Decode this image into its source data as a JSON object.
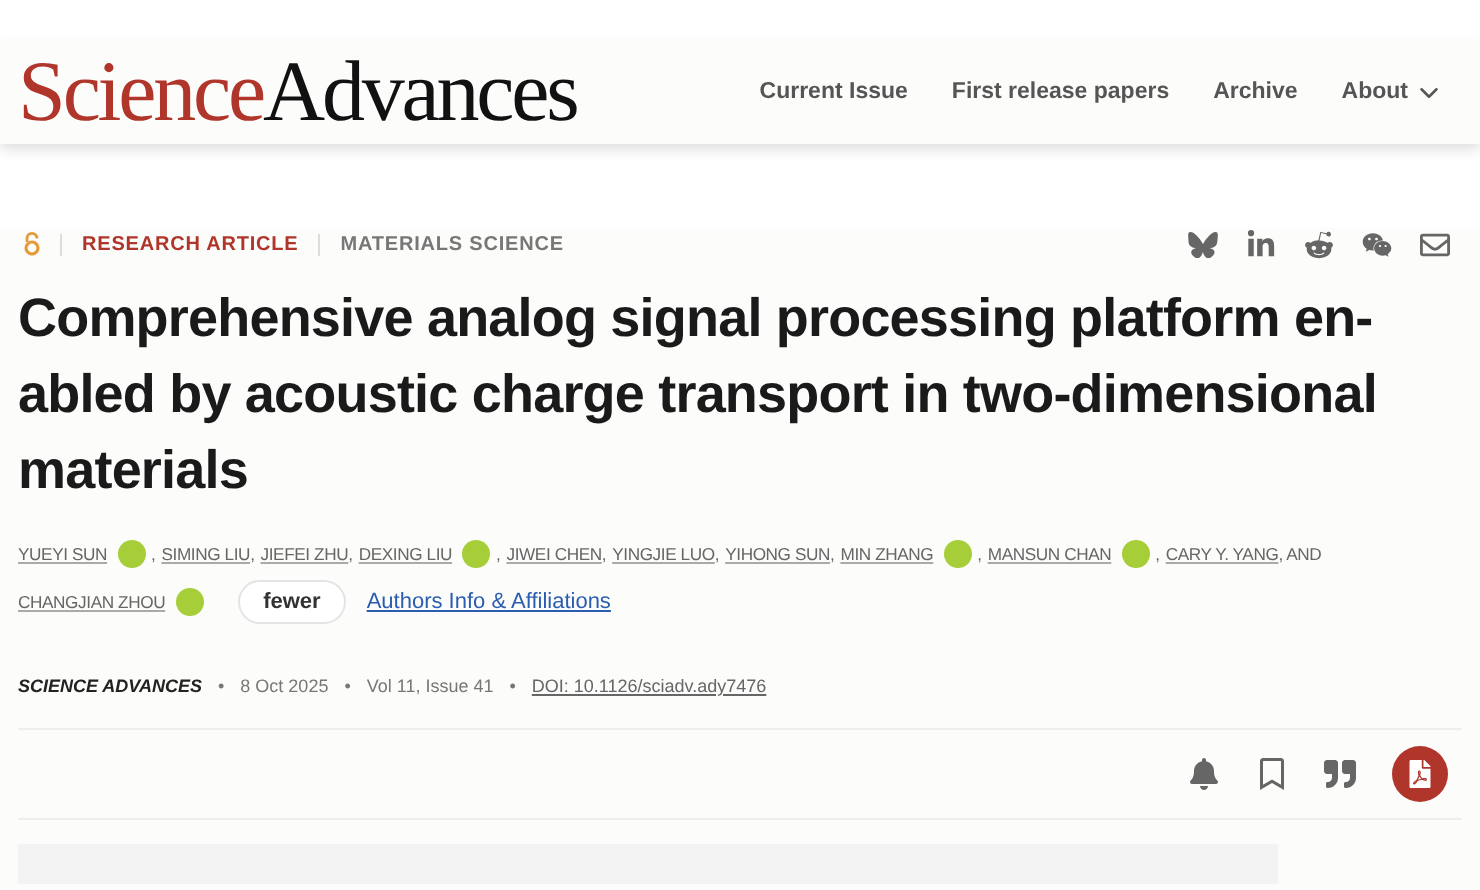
{
  "header": {
    "logo": {
      "part_1": "Science",
      "part_2": "Advances"
    },
    "nav": [
      {
        "label": "Current Issue",
        "dropdown": false
      },
      {
        "label": "First release papers",
        "dropdown": false
      },
      {
        "label": "Archive",
        "dropdown": false
      },
      {
        "label": "About",
        "dropdown": true
      }
    ]
  },
  "article": {
    "open_access": true,
    "type": "RESEARCH ARTICLE",
    "subject": "MATERIALS SCIENCE",
    "share": [
      {
        "kind": "bluesky"
      },
      {
        "kind": "linkedin"
      },
      {
        "kind": "reddit"
      },
      {
        "kind": "wechat"
      },
      {
        "kind": "email"
      }
    ],
    "title_lines": [
      "Comprehensive analog signal processing platform en-",
      "abled by acoustic charge transport in two-dimensional",
      "materials"
    ],
    "author_lines": [
      [
        {
          "name": "YUEYI SUN",
          "orcid": true,
          "suffix": ","
        },
        {
          "name": "SIMING LIU",
          "orcid": false,
          "suffix": ","
        },
        {
          "name": "JIEFEI ZHU",
          "orcid": false,
          "suffix": ","
        },
        {
          "name": "DEXING LIU",
          "orcid": true,
          "suffix": ","
        },
        {
          "name": "JIWEI CHEN",
          "orcid": false,
          "suffix": ","
        },
        {
          "name": "YINGJIE LUO",
          "orcid": false,
          "suffix": ","
        },
        {
          "name": "YIHONG SUN",
          "orcid": false,
          "suffix": ","
        },
        {
          "name": "MIN ZHANG",
          "orcid": true,
          "suffix": ","
        },
        {
          "name": "MANSUN CHAN",
          "orcid": true,
          "suffix": ","
        },
        {
          "name": "CARY Y. YANG",
          "orcid": false,
          "suffix": ", AND"
        }
      ],
      [
        {
          "name": "CHANGJIAN ZHOU",
          "orcid": true
        }
      ]
    ],
    "fewer_button": "fewer",
    "affiliations_link": "Authors Info & Affiliations",
    "meta": {
      "separator": "•",
      "journal": "SCIENCE ADVANCES",
      "date": "8 Oct 2025",
      "volume": "Vol 11, Issue 41",
      "doi": "DOI: 10.1126/sciadv.ady7476"
    },
    "actions": [
      {
        "kind": "alert"
      },
      {
        "kind": "bookmark"
      },
      {
        "kind": "cite"
      },
      {
        "kind": "pdf"
      }
    ]
  }
}
